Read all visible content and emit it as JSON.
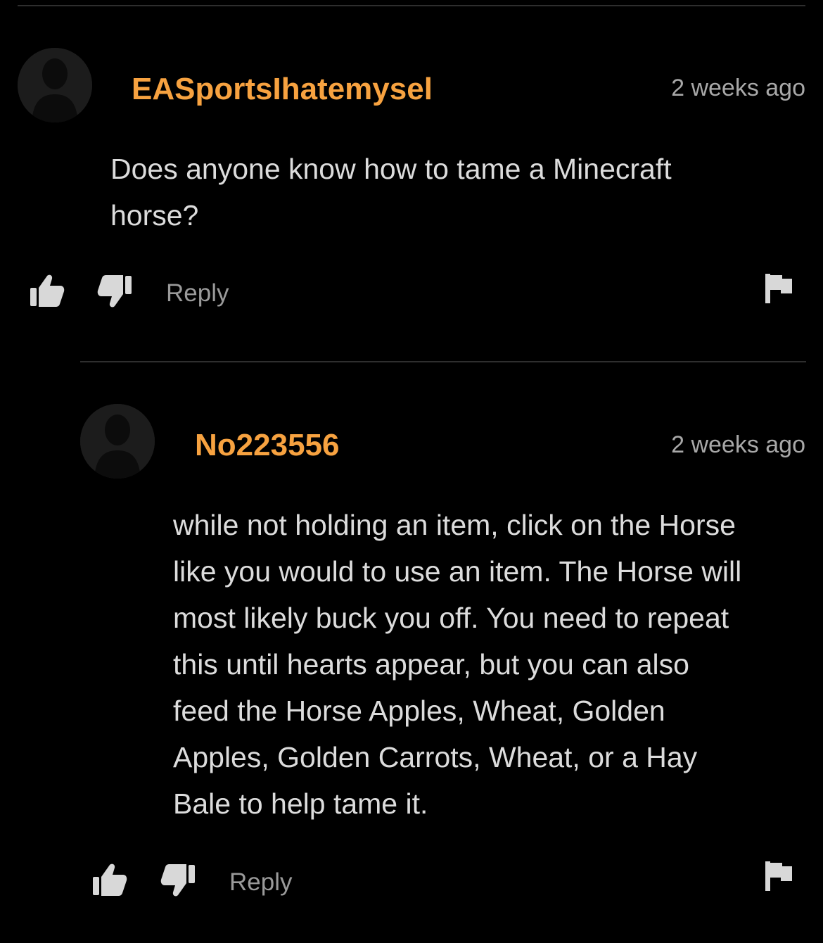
{
  "comments": [
    {
      "username": "EASportsIhatemysel",
      "timestamp": "2 weeks ago",
      "body_lines": [
        "Does anyone know how to tame a Minecraft",
        "horse?"
      ],
      "reply_label": "Reply"
    },
    {
      "username": "No223556",
      "timestamp": "2 weeks ago",
      "body_lines": [
        "while not holding an item, click on the Horse",
        "like you would to use an item. The Horse will",
        "most likely buck you off. You need to repeat",
        "this until hearts appear, but you can also",
        "feed the Horse Apples, Wheat, Golden",
        "Apples, Golden Carrots, Wheat, or a Hay",
        "Bale to help tame it."
      ],
      "reply_label": "Reply"
    }
  ],
  "icons": {
    "avatar": "default-user-avatar-icon",
    "like": "thumbs-up-icon",
    "dislike": "thumbs-down-icon",
    "flag": "flag-icon"
  },
  "colors": {
    "background": "#000000",
    "username": "#f7a240",
    "timestamp": "#a8a8a8",
    "body": "#dcdcdc",
    "action": "#9a9a9a",
    "icon": "#d8d8d8"
  }
}
